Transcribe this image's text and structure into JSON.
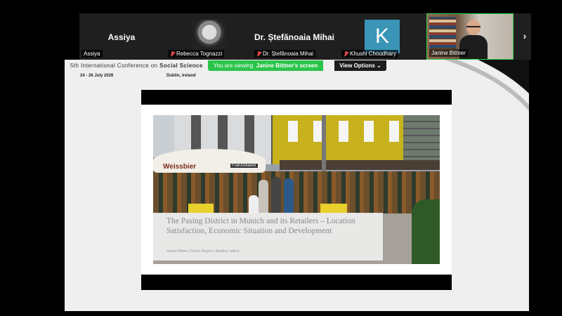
{
  "participants": [
    {
      "big_name": "Assiya",
      "label": "Assiya",
      "muted": false
    },
    {
      "big_name": "",
      "label": "Rebecca Tognazzi",
      "muted": true
    },
    {
      "big_name": "Dr. Ștefănoaia Mihai",
      "label": "Dr. Ștefănoaia Mihai",
      "muted": true
    },
    {
      "big_name": "",
      "avatar_letter": "K",
      "label": "Khushi Choudhary",
      "muted": true
    },
    {
      "label": "Janine Bittner",
      "active_speaker": true
    }
  ],
  "next_arrow": "›",
  "share_banner": {
    "prefix": "You are viewing",
    "owner": "Janine Bittner's screen"
  },
  "view_options_label": "View Options",
  "slide": {
    "conference_prefix": "5th International Conference on ",
    "conference_bold": "Social Science",
    "dates": "24 - 26 July 2026",
    "location": "Dublin, Ireland",
    "title": "The Pasing District in Munich and its Retailers – Location Satisfaction, Economic Situation and Development",
    "authors": "Janine Bittner, Florian Angerer, Martina Liebich",
    "photo_sign": "Weissbier",
    "photo_sign2": "Franziskaner"
  },
  "colors": {
    "accent_green": "#2bc44a",
    "avatar_k": "#3a95b6",
    "active_border": "#2ed14a"
  }
}
